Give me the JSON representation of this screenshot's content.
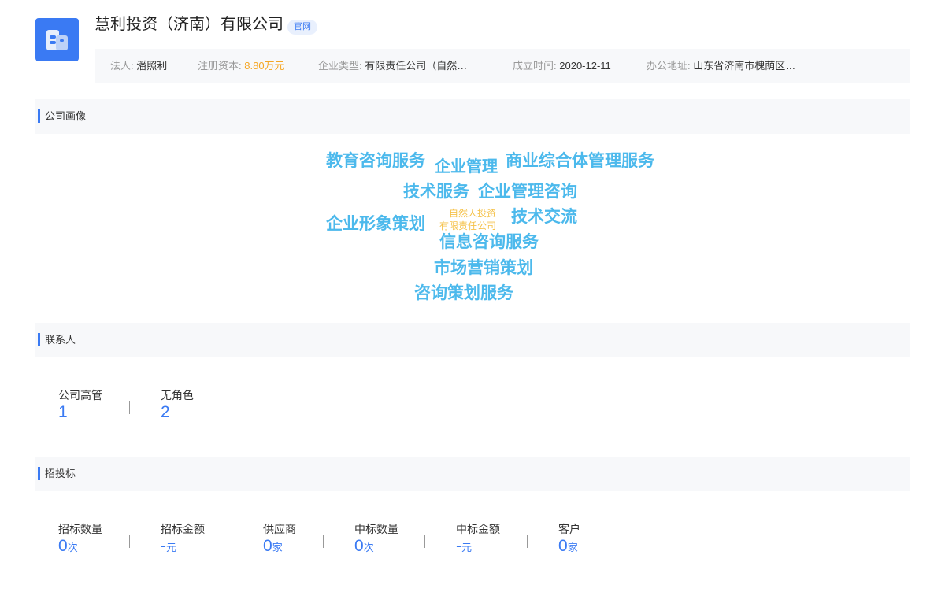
{
  "company": {
    "name": "慧利投资（济南）有限公司",
    "badge": "官网",
    "logo_icon": "building-icon",
    "brand_color": "#3a7af3"
  },
  "info": {
    "legal_label": "法人:",
    "legal_value": "潘照利",
    "capital_label": "注册资本:",
    "capital_value": "8.80万元",
    "type_label": "企业类型:",
    "type_value": "有限责任公司（自然…",
    "founded_label": "成立时间:",
    "founded_value": "2020-12-11",
    "address_label": "办公地址:",
    "address_value": "山东省济南市槐荫区…"
  },
  "portrait": {
    "title": "公司画像",
    "words": [
      "教育咨询服务",
      "企业管理",
      "商业综合体管理服务",
      "技术服务",
      "企业管理咨询",
      "企业形象策划",
      "自然人投资",
      "有限责任公司",
      "技术交流",
      "信息咨询服务",
      "市场营销策划",
      "咨询策划服务"
    ],
    "word_color": "#4cb9ec",
    "highlight_color": "#f5c24a"
  },
  "contacts": {
    "title": "联系人",
    "stats": [
      {
        "label": "公司高管",
        "value": "1"
      },
      {
        "label": "无角色",
        "value": "2"
      }
    ]
  },
  "bidding": {
    "title": "招投标",
    "stats": [
      {
        "label": "招标数量",
        "value": "0",
        "unit": "次"
      },
      {
        "label": "招标金额",
        "value": "-",
        "unit": "元"
      },
      {
        "label": "供应商",
        "value": "0",
        "unit": "家"
      },
      {
        "label": "中标数量",
        "value": "0",
        "unit": "次"
      },
      {
        "label": "中标金额",
        "value": "-",
        "unit": "元"
      },
      {
        "label": "客户",
        "value": "0",
        "unit": "家"
      }
    ]
  }
}
